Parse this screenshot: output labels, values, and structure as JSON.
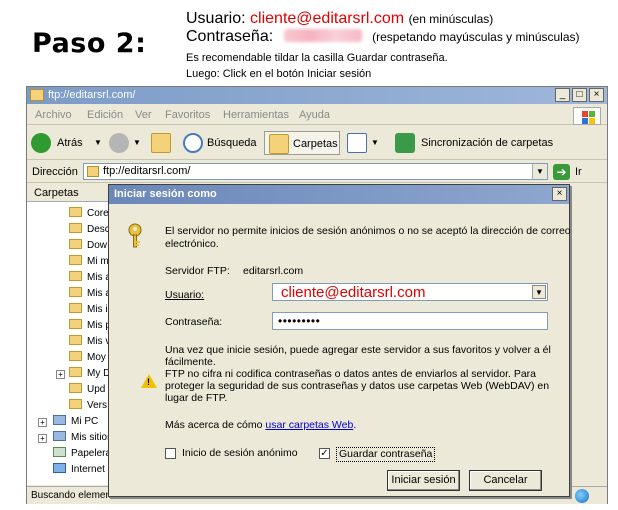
{
  "instructions": {
    "step": "Paso 2:",
    "user_label": "Usuario:",
    "user_value": "cliente@editarsrl.com",
    "user_note": "(en minúsculas)",
    "pass_label": "Contraseña:",
    "pass_note": "(respetando mayúsculas y minúsculas)",
    "tip1": "Es recomendable tildar la casilla Guardar contraseña.",
    "tip2": "Luego: Click en el botón Iniciar sesión"
  },
  "window": {
    "title": "ftp://editarsrl.com/",
    "menu": [
      "Archivo",
      "Edición",
      "Ver",
      "Favoritos",
      "Herramientas",
      "Ayuda"
    ],
    "toolbar": {
      "back": "Atrás",
      "search": "Búsqueda",
      "folders": "Carpetas",
      "sync": "Sincronización de carpetas"
    },
    "address_label": "Dirección",
    "address_value": "ftp://editarsrl.com/",
    "go_label": "Ir",
    "folders_header": "Carpetas",
    "tree": [
      "Core",
      "Desc",
      "Dow",
      "Mi m",
      "Mis a",
      "Mis a",
      "Mis i",
      "Mis p",
      "Mis v",
      "Moy",
      "My D",
      "Upd",
      "Vers",
      "Mi PC",
      "Mis sitios",
      "Papelera",
      "Internet"
    ],
    "status": "Buscando elemen"
  },
  "dialog": {
    "title": "Iniciar sesión como",
    "message": [
      "El servidor no permite inicios de sesión anónimos o no se aceptó la  dirección de correo",
      "electrónico."
    ],
    "server_label": "Servidor FTP:",
    "server_value": "editarsrl.com",
    "user_label": "Usuario:",
    "user_value": "cliente@editarsrl.com",
    "pass_label": "Contraseña:",
    "pass_value": "•••••••••",
    "info": [
      "Una vez que inicie sesión, puede agregar este servidor a sus favoritos y volver a él",
      "fácilmente."
    ],
    "warning": [
      "FTP no cifra ni codifica contraseñas o datos antes de enviarlos al servidor.  Para",
      "proteger la seguridad de sus contraseñas y datos use carpetas Web (WebDAV) en",
      "lugar de FTP."
    ],
    "more_prefix": "Más acerca de cómo",
    "more_link": "usar carpetas Web",
    "anon_label": "Inicio de sesión anónimo",
    "save_label": "Guardar contraseña",
    "save_checked": "✓",
    "login_button": "Iniciar sesión",
    "cancel_button": "Cancelar"
  },
  "colors": {
    "accent_red": "#e00000",
    "title_blue": "#7b9bc7",
    "link": "#0000cc"
  }
}
